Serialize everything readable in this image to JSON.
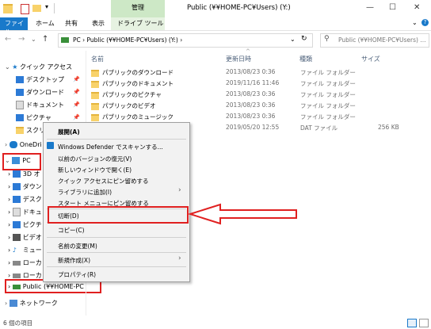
{
  "window": {
    "title": "Public (¥¥HOME-PC¥Users) (Y:)",
    "context_tab_group": "管理",
    "minimize_glyph": "—",
    "maximize_glyph": "☐",
    "close_glyph": "✕"
  },
  "ribbon": {
    "tabs": [
      "ファイル",
      "ホーム",
      "共有",
      "表示"
    ],
    "context_tab": "ドライブ ツール"
  },
  "address": {
    "path": "PC  ›  Public (¥¥HOME-PC¥Users) (Y:)  ›",
    "search_placeholder": "Public (¥¥HOME-PC¥Users) ..."
  },
  "nav": {
    "quick_access": "クイック アクセス",
    "items": [
      "デスクトップ",
      "ダウンロード",
      "ドキュメント",
      "ピクチャ",
      "スクリ"
    ],
    "onedrive": "OneDri",
    "pc": "PC",
    "pc_children": [
      "3D オ",
      "ダウン",
      "デスク",
      "ドキュ",
      "ピクチ",
      "ビデオ",
      "ミュー",
      "ローカ",
      "ローカ"
    ],
    "public_drive": "Public (¥¥HOME-PC",
    "network": "ネットワーク"
  },
  "columns": {
    "name": "名前",
    "date": "更新日時",
    "type": "種類",
    "size": "サイズ"
  },
  "files": [
    {
      "name": "パブリックのダウンロード",
      "date": "2013/08/23 0:36",
      "type": "ファイル フォルダー",
      "size": ""
    },
    {
      "name": "パブリックのドキュメント",
      "date": "2019/11/16 11:46",
      "type": "ファイル フォルダー",
      "size": ""
    },
    {
      "name": "パブリックのピクチャ",
      "date": "2013/08/23 0:36",
      "type": "ファイル フォルダー",
      "size": ""
    },
    {
      "name": "パブリックのビデオ",
      "date": "2013/08/23 0:36",
      "type": "ファイル フォルダー",
      "size": ""
    },
    {
      "name": "パブリックのミュージック",
      "date": "2013/08/23 0:36",
      "type": "ファイル フォルダー",
      "size": ""
    },
    {
      "name": "",
      "date": "2019/05/20 12:55",
      "type": "DAT ファイル",
      "size": "256 KB"
    }
  ],
  "context_menu": {
    "expand": "展開(A)",
    "defender": "Windows Defender でスキャンする...",
    "restore": "以前のバージョンの復元(V)",
    "open_new_window": "新しいウィンドウで開く(E)",
    "pin_quick": "クイック アクセスにピン留めする",
    "add_library": "ライブラリに追加(I)",
    "pin_start": "スタート メニューにピン留めする",
    "cut": "切断(D)",
    "copy": "コピー(C)",
    "rename": "名前の変更(M)",
    "new": "新規作成(X)",
    "properties": "プロパティ(R)"
  },
  "status": {
    "items": "6 個の項目"
  },
  "colors": {
    "accent": "#1979ca",
    "highlight": "#e02020",
    "manage": "#cde8c6"
  }
}
